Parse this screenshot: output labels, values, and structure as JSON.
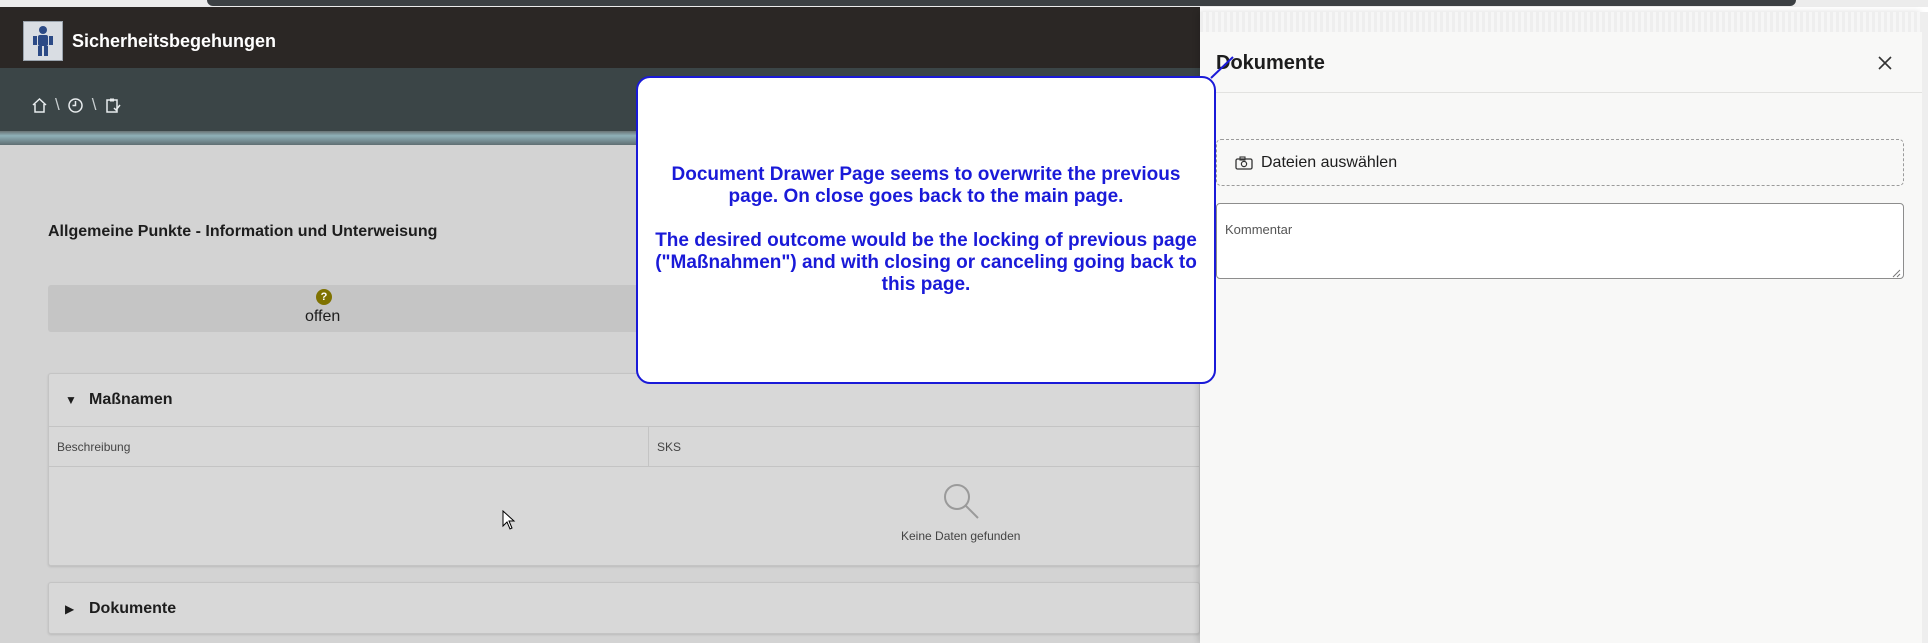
{
  "app": {
    "title": "Sicherheitsbegehungen"
  },
  "breadcrumb": {
    "items": [
      "home-icon",
      "clock-icon",
      "clipboard-check-icon"
    ],
    "separator": "\\"
  },
  "main": {
    "section_title": "Allgemeine Punkte - Information und Unterweisung",
    "status": {
      "icon": "?",
      "label": "offen",
      "icon_color": "#7f7200"
    },
    "massnahmen": {
      "title": "Maßnamen",
      "columns": [
        "Beschreibung",
        "SKS"
      ],
      "empty_text": "Keine Daten gefunden"
    },
    "dokumente": {
      "title": "Dokumente"
    }
  },
  "drawer": {
    "title": "Dokumente",
    "file_button": "Dateien auswählen",
    "comment_placeholder": "Kommentar"
  },
  "annotation": {
    "paragraph1": "Document Drawer Page seems to overwrite the previous page. On close goes back to the main page.",
    "paragraph2": "The desired outcome would be the locking of previous page (\"Maßnahmen\") and with closing or canceling going back to this page.",
    "color": "#1a1ad8"
  }
}
